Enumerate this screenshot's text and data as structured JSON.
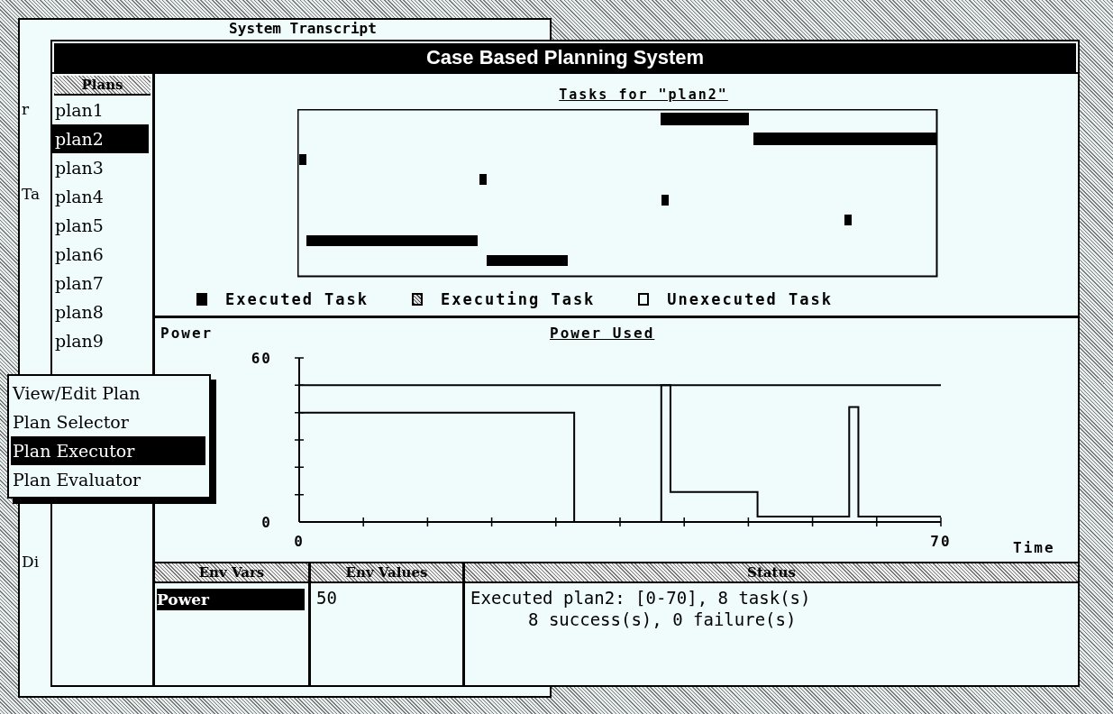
{
  "background_window": {
    "title": "System Transcript",
    "fragments": [
      "r",
      "Ta",
      "Di"
    ]
  },
  "window": {
    "title": "Case Based Planning System"
  },
  "plans": {
    "header": "Plans",
    "items": [
      {
        "label": "plan1",
        "selected": false
      },
      {
        "label": "plan2",
        "selected": true
      },
      {
        "label": "plan3",
        "selected": false
      },
      {
        "label": "plan4",
        "selected": false
      },
      {
        "label": "plan5",
        "selected": false
      },
      {
        "label": "plan6",
        "selected": false
      },
      {
        "label": "plan7",
        "selected": false
      },
      {
        "label": "plan8",
        "selected": false
      },
      {
        "label": "plan9",
        "selected": false
      }
    ]
  },
  "tasks_panel": {
    "title": "Tasks for \"plan2\"",
    "legend": [
      {
        "kind": "executed",
        "label": "Executed Task"
      },
      {
        "kind": "executing",
        "label": "Executing Task"
      },
      {
        "kind": "unexecuted",
        "label": "Unexecuted Task"
      }
    ]
  },
  "power_panel": {
    "chart_data": {
      "type": "line",
      "title": "Power Used",
      "xlabel": "Time",
      "ylabel": "Power",
      "x": [
        0,
        30,
        30,
        39.5,
        39.5,
        40.5,
        40.5,
        50,
        50,
        60,
        60,
        61,
        61,
        70
      ],
      "series": [
        {
          "color": "#000000",
          "values": [
            40,
            40,
            0,
            0,
            50,
            50,
            11,
            11,
            2,
            2,
            42,
            42,
            2,
            2
          ]
        },
        {
          "color": "#000000",
          "values": [
            50,
            50,
            50,
            50,
            50,
            50,
            50,
            50,
            50,
            50,
            50,
            50,
            50,
            50
          ]
        }
      ],
      "xlim": [
        0,
        70
      ],
      "ylim": [
        0,
        60
      ],
      "xticks": [
        0,
        70
      ],
      "yticks": [
        0,
        60
      ]
    }
  },
  "env_vars": {
    "header": "Env Vars",
    "items": [
      {
        "label": "Power",
        "selected": true
      }
    ]
  },
  "env_values": {
    "header": "Env Values",
    "items": [
      "50"
    ]
  },
  "status": {
    "header": "Status",
    "lines": [
      "Executed plan2: [0-70], 8 task(s)",
      "8 success(s), 0 failure(s)"
    ]
  },
  "menu": {
    "items": [
      {
        "label": "View/Edit Plan",
        "selected": false
      },
      {
        "label": "Plan Selector",
        "selected": false
      },
      {
        "label": "Plan Executor",
        "selected": true
      },
      {
        "label": "Plan Evaluator",
        "selected": false
      }
    ]
  }
}
